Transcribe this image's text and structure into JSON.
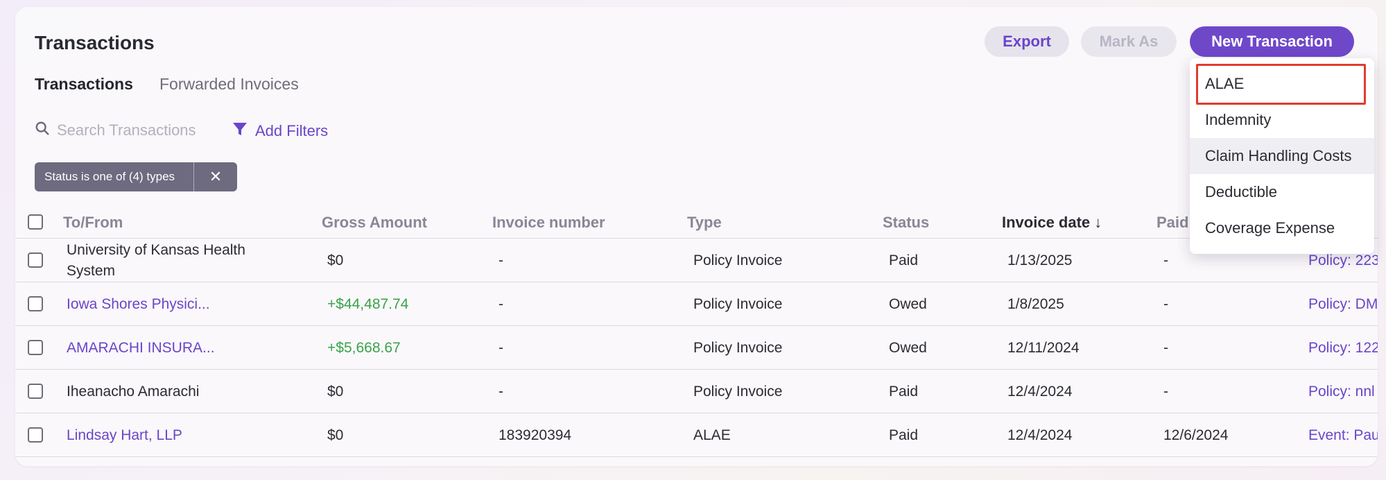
{
  "page": {
    "title": "Transactions"
  },
  "toolbar": {
    "export_label": "Export",
    "mark_as_label": "Mark As",
    "new_transaction_label": "New Transaction"
  },
  "tabs": [
    {
      "label": "Transactions",
      "active": true
    },
    {
      "label": "Forwarded Invoices",
      "active": false
    }
  ],
  "search": {
    "placeholder": "Search Transactions",
    "value": ""
  },
  "filters": {
    "add_label": "Add Filters",
    "chips": [
      {
        "label": "Status is one of (4) types",
        "close": "✕"
      }
    ]
  },
  "table": {
    "columns": [
      "To/From",
      "Gross Amount",
      "Invoice number",
      "Type",
      "Status",
      "Invoice date ↓",
      "Paid"
    ],
    "rows": [
      {
        "to_from": "University of Kansas Health System",
        "gross": "$0",
        "invoice_no": "-",
        "type": "Policy Invoice",
        "status": "Paid",
        "invoice_date": "1/13/2025",
        "paid": "-",
        "ref": "Policy: 223"
      },
      {
        "to_from": "Iowa Shores Physici...",
        "gross": "+$44,487.74",
        "invoice_no": "-",
        "type": "Policy Invoice",
        "status": "Owed",
        "invoice_date": "1/8/2025",
        "paid": "-",
        "ref": "Policy: DM"
      },
      {
        "to_from": "AMARACHI INSURA...",
        "gross": "+$5,668.67",
        "invoice_no": "-",
        "type": "Policy Invoice",
        "status": "Owed",
        "invoice_date": "12/11/2024",
        "paid": "-",
        "ref": "Policy: 122"
      },
      {
        "to_from": "Iheanacho Amarachi",
        "gross": "$0",
        "invoice_no": "-",
        "type": "Policy Invoice",
        "status": "Paid",
        "invoice_date": "12/4/2024",
        "paid": "-",
        "ref": "Policy: nnl"
      },
      {
        "to_from": "Lindsay Hart, LLP",
        "gross": "$0",
        "invoice_no": "183920394",
        "type": "ALAE",
        "status": "Paid",
        "invoice_date": "12/4/2024",
        "paid": "12/6/2024",
        "ref": "Event: Pau"
      }
    ]
  },
  "dropdown": {
    "items": [
      "ALAE",
      "Indemnity",
      "Claim Handling Costs",
      "Deductible",
      "Coverage Expense"
    ],
    "highlighted": "ALAE",
    "hovered": "Claim Handling Costs"
  },
  "colors": {
    "accent": "#6f48c9",
    "link": "#6a45c9",
    "positive": "#3aa34a",
    "highlight_border": "#e23b2e"
  }
}
